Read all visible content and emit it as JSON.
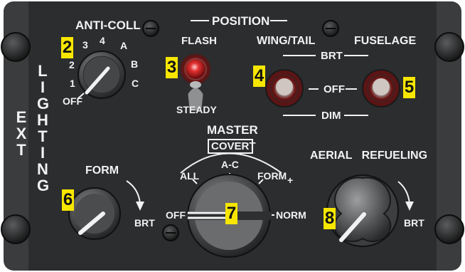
{
  "panel": {
    "colors": {
      "panel": "#2b2d2f",
      "frame": "#3a3c3e",
      "text": "#f2f2f2",
      "callout_bg": "#f7e600",
      "lamp_red": "#d01818"
    },
    "side_label_1": "EXT",
    "side_label_2": "LIGHTING"
  },
  "anti_coll": {
    "title": "ANTI-COLL",
    "positions": [
      "OFF",
      "1",
      "2",
      "3",
      "4",
      "A",
      "B",
      "C"
    ]
  },
  "position": {
    "title": "POSITION",
    "flash_label": "FLASH",
    "steady_label": "STEADY",
    "wing_tail_label": "WING/TAIL",
    "fuselage_label": "FUSELAGE",
    "brt_label": "BRT",
    "off_label": "OFF",
    "dim_label": "DIM"
  },
  "master": {
    "title": "MASTER",
    "covert_label": "COVERT",
    "positions": {
      "off": "OFF",
      "all": "ALL",
      "ac": "A-C",
      "form": "FORM",
      "form_plus": "+",
      "norm": "NORM"
    }
  },
  "form": {
    "title": "FORM",
    "brt_label": "BRT"
  },
  "aerial_refueling": {
    "title": "AERIAL   REFUELING",
    "brt_label": "BRT"
  },
  "callouts": [
    "2",
    "3",
    "4",
    "5",
    "6",
    "7",
    "8"
  ]
}
